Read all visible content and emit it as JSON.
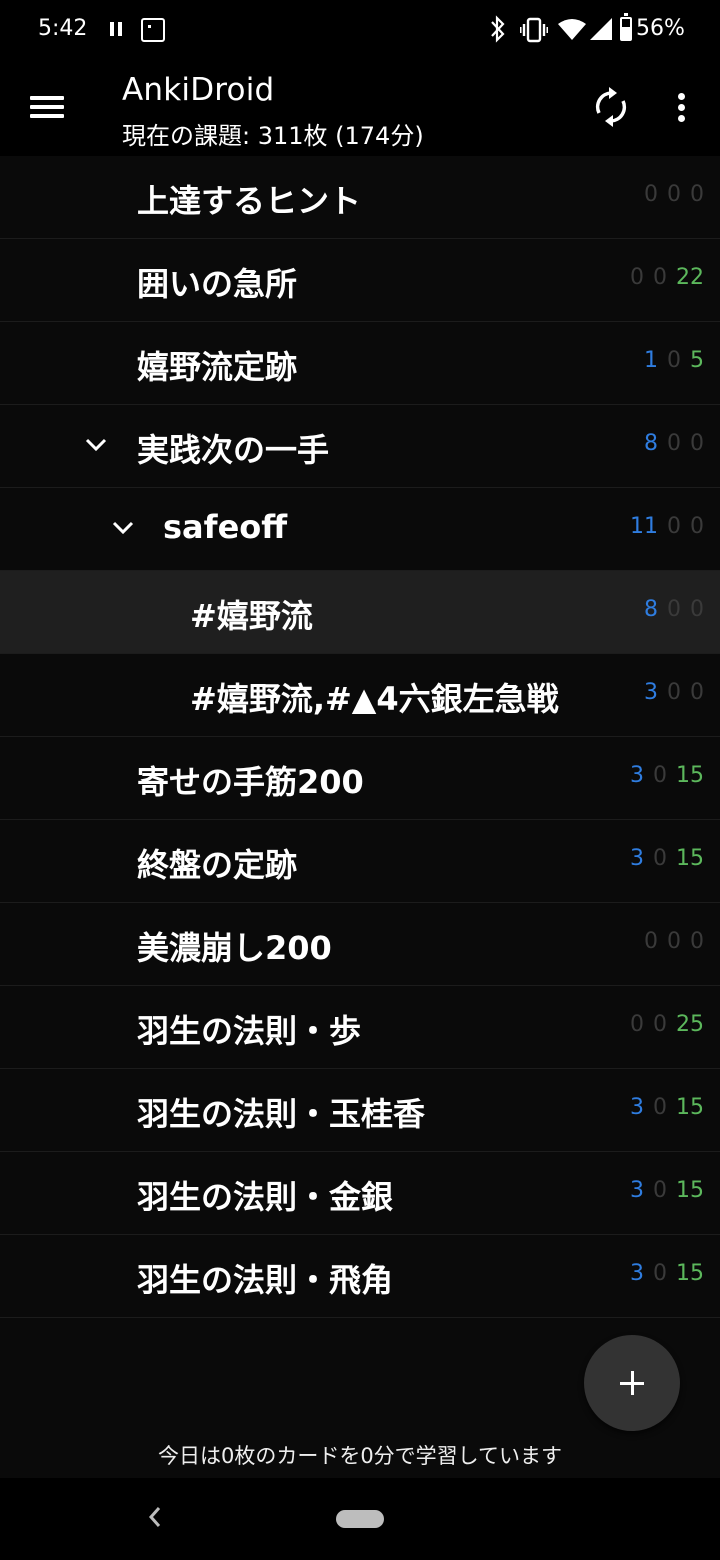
{
  "status_bar": {
    "time": "5:42",
    "battery_pct": "56%",
    "icons": [
      "pause-icon",
      "photo-icon",
      "bluetooth-icon",
      "vibrate-icon",
      "wifi-icon",
      "cell-signal-icon",
      "battery-icon"
    ]
  },
  "app_bar": {
    "title": "AnkiDroid",
    "subtitle": "現在の課題: 311枚 (174分)",
    "icons": [
      "menu-icon",
      "sync-icon",
      "more-vert-icon"
    ]
  },
  "colors": {
    "new": "#2f7de0",
    "learning": "#6b6b6b",
    "review": "#5cb85c",
    "zero": "#3a3a3a",
    "background": "#0a0a0a"
  },
  "decks": [
    {
      "name": "上達するヒント",
      "new": "0",
      "learn": "0",
      "review": "0"
    },
    {
      "name": "囲いの急所",
      "new": "0",
      "learn": "0",
      "review": "22"
    },
    {
      "name": "嬉野流定跡",
      "new": "1",
      "learn": "0",
      "review": "5"
    },
    {
      "name": "実践次の一手",
      "new": "8",
      "learn": "0",
      "review": "0",
      "expanded": true
    },
    {
      "name": "safeoff",
      "new": "11",
      "learn": "0",
      "review": "0",
      "expanded": true
    },
    {
      "name": "#嬉野流",
      "new": "8",
      "learn": "0",
      "review": "0",
      "selected": true
    },
    {
      "name": "#嬉野流,#▲4六銀左急戦",
      "new": "3",
      "learn": "0",
      "review": "0"
    },
    {
      "name": "寄せの手筋200",
      "new": "3",
      "learn": "0",
      "review": "15"
    },
    {
      "name": "終盤の定跡",
      "new": "3",
      "learn": "0",
      "review": "15"
    },
    {
      "name": "美濃崩し200",
      "new": "0",
      "learn": "0",
      "review": "0"
    },
    {
      "name": "羽生の法則・歩",
      "new": "0",
      "learn": "0",
      "review": "25"
    },
    {
      "name": "羽生の法則・玉桂香",
      "new": "3",
      "learn": "0",
      "review": "15"
    },
    {
      "name": "羽生の法則・金銀",
      "new": "3",
      "learn": "0",
      "review": "15"
    },
    {
      "name": "羽生の法則・飛角",
      "new": "3",
      "learn": "0",
      "review": "15"
    }
  ],
  "footer": {
    "studied_today": "今日は0枚のカードを0分で学習しています"
  },
  "fab": {
    "icon": "plus-icon"
  },
  "nav_bar": {
    "icons": [
      "back-icon",
      "home-pill-icon"
    ]
  }
}
